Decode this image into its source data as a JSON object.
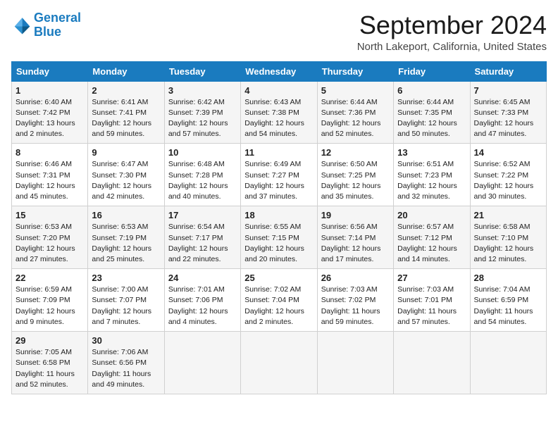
{
  "logo": {
    "line1": "General",
    "line2": "Blue"
  },
  "title": "September 2024",
  "subtitle": "North Lakeport, California, United States",
  "weekdays": [
    "Sunday",
    "Monday",
    "Tuesday",
    "Wednesday",
    "Thursday",
    "Friday",
    "Saturday"
  ],
  "weeks": [
    [
      {
        "day": 1,
        "sunrise": "Sunrise: 6:40 AM",
        "sunset": "Sunset: 7:42 PM",
        "daylight": "Daylight: 13 hours and 2 minutes."
      },
      {
        "day": 2,
        "sunrise": "Sunrise: 6:41 AM",
        "sunset": "Sunset: 7:41 PM",
        "daylight": "Daylight: 12 hours and 59 minutes."
      },
      {
        "day": 3,
        "sunrise": "Sunrise: 6:42 AM",
        "sunset": "Sunset: 7:39 PM",
        "daylight": "Daylight: 12 hours and 57 minutes."
      },
      {
        "day": 4,
        "sunrise": "Sunrise: 6:43 AM",
        "sunset": "Sunset: 7:38 PM",
        "daylight": "Daylight: 12 hours and 54 minutes."
      },
      {
        "day": 5,
        "sunrise": "Sunrise: 6:44 AM",
        "sunset": "Sunset: 7:36 PM",
        "daylight": "Daylight: 12 hours and 52 minutes."
      },
      {
        "day": 6,
        "sunrise": "Sunrise: 6:44 AM",
        "sunset": "Sunset: 7:35 PM",
        "daylight": "Daylight: 12 hours and 50 minutes."
      },
      {
        "day": 7,
        "sunrise": "Sunrise: 6:45 AM",
        "sunset": "Sunset: 7:33 PM",
        "daylight": "Daylight: 12 hours and 47 minutes."
      }
    ],
    [
      {
        "day": 8,
        "sunrise": "Sunrise: 6:46 AM",
        "sunset": "Sunset: 7:31 PM",
        "daylight": "Daylight: 12 hours and 45 minutes."
      },
      {
        "day": 9,
        "sunrise": "Sunrise: 6:47 AM",
        "sunset": "Sunset: 7:30 PM",
        "daylight": "Daylight: 12 hours and 42 minutes."
      },
      {
        "day": 10,
        "sunrise": "Sunrise: 6:48 AM",
        "sunset": "Sunset: 7:28 PM",
        "daylight": "Daylight: 12 hours and 40 minutes."
      },
      {
        "day": 11,
        "sunrise": "Sunrise: 6:49 AM",
        "sunset": "Sunset: 7:27 PM",
        "daylight": "Daylight: 12 hours and 37 minutes."
      },
      {
        "day": 12,
        "sunrise": "Sunrise: 6:50 AM",
        "sunset": "Sunset: 7:25 PM",
        "daylight": "Daylight: 12 hours and 35 minutes."
      },
      {
        "day": 13,
        "sunrise": "Sunrise: 6:51 AM",
        "sunset": "Sunset: 7:23 PM",
        "daylight": "Daylight: 12 hours and 32 minutes."
      },
      {
        "day": 14,
        "sunrise": "Sunrise: 6:52 AM",
        "sunset": "Sunset: 7:22 PM",
        "daylight": "Daylight: 12 hours and 30 minutes."
      }
    ],
    [
      {
        "day": 15,
        "sunrise": "Sunrise: 6:53 AM",
        "sunset": "Sunset: 7:20 PM",
        "daylight": "Daylight: 12 hours and 27 minutes."
      },
      {
        "day": 16,
        "sunrise": "Sunrise: 6:53 AM",
        "sunset": "Sunset: 7:19 PM",
        "daylight": "Daylight: 12 hours and 25 minutes."
      },
      {
        "day": 17,
        "sunrise": "Sunrise: 6:54 AM",
        "sunset": "Sunset: 7:17 PM",
        "daylight": "Daylight: 12 hours and 22 minutes."
      },
      {
        "day": 18,
        "sunrise": "Sunrise: 6:55 AM",
        "sunset": "Sunset: 7:15 PM",
        "daylight": "Daylight: 12 hours and 20 minutes."
      },
      {
        "day": 19,
        "sunrise": "Sunrise: 6:56 AM",
        "sunset": "Sunset: 7:14 PM",
        "daylight": "Daylight: 12 hours and 17 minutes."
      },
      {
        "day": 20,
        "sunrise": "Sunrise: 6:57 AM",
        "sunset": "Sunset: 7:12 PM",
        "daylight": "Daylight: 12 hours and 14 minutes."
      },
      {
        "day": 21,
        "sunrise": "Sunrise: 6:58 AM",
        "sunset": "Sunset: 7:10 PM",
        "daylight": "Daylight: 12 hours and 12 minutes."
      }
    ],
    [
      {
        "day": 22,
        "sunrise": "Sunrise: 6:59 AM",
        "sunset": "Sunset: 7:09 PM",
        "daylight": "Daylight: 12 hours and 9 minutes."
      },
      {
        "day": 23,
        "sunrise": "Sunrise: 7:00 AM",
        "sunset": "Sunset: 7:07 PM",
        "daylight": "Daylight: 12 hours and 7 minutes."
      },
      {
        "day": 24,
        "sunrise": "Sunrise: 7:01 AM",
        "sunset": "Sunset: 7:06 PM",
        "daylight": "Daylight: 12 hours and 4 minutes."
      },
      {
        "day": 25,
        "sunrise": "Sunrise: 7:02 AM",
        "sunset": "Sunset: 7:04 PM",
        "daylight": "Daylight: 12 hours and 2 minutes."
      },
      {
        "day": 26,
        "sunrise": "Sunrise: 7:03 AM",
        "sunset": "Sunset: 7:02 PM",
        "daylight": "Daylight: 11 hours and 59 minutes."
      },
      {
        "day": 27,
        "sunrise": "Sunrise: 7:03 AM",
        "sunset": "Sunset: 7:01 PM",
        "daylight": "Daylight: 11 hours and 57 minutes."
      },
      {
        "day": 28,
        "sunrise": "Sunrise: 7:04 AM",
        "sunset": "Sunset: 6:59 PM",
        "daylight": "Daylight: 11 hours and 54 minutes."
      }
    ],
    [
      {
        "day": 29,
        "sunrise": "Sunrise: 7:05 AM",
        "sunset": "Sunset: 6:58 PM",
        "daylight": "Daylight: 11 hours and 52 minutes."
      },
      {
        "day": 30,
        "sunrise": "Sunrise: 7:06 AM",
        "sunset": "Sunset: 6:56 PM",
        "daylight": "Daylight: 11 hours and 49 minutes."
      },
      null,
      null,
      null,
      null,
      null
    ]
  ]
}
